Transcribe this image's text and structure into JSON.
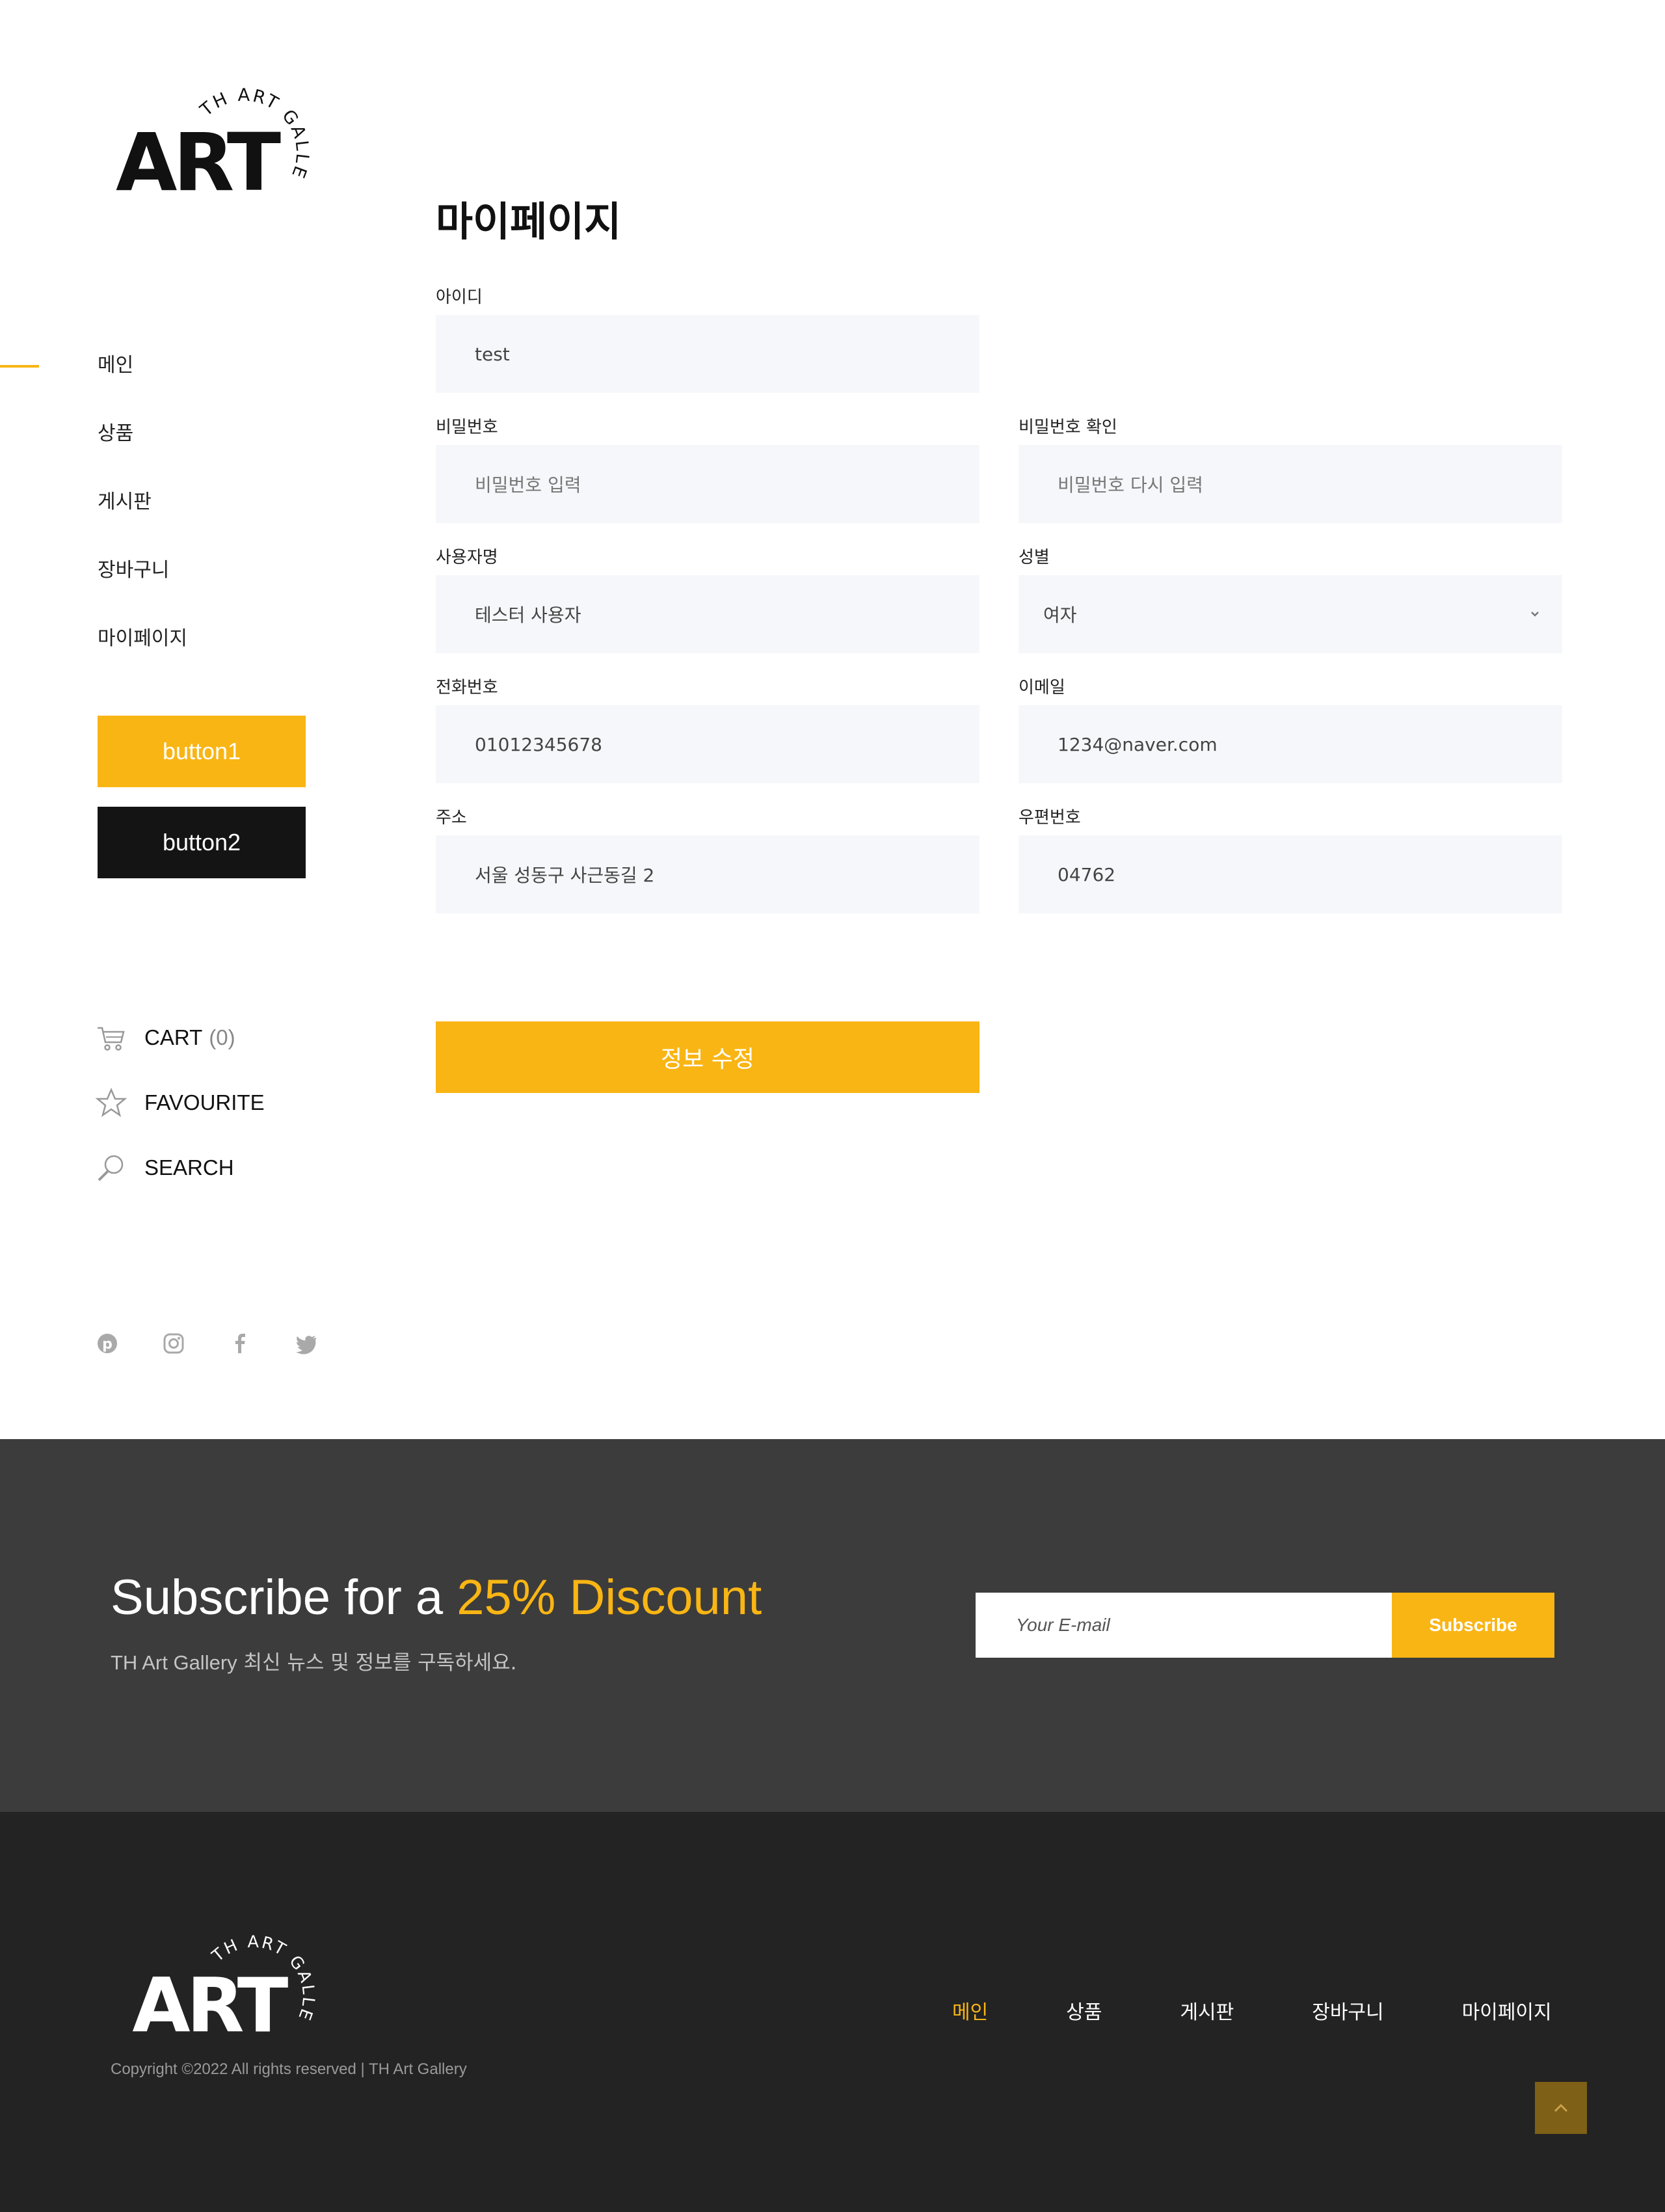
{
  "brand": {
    "logo_text": "ART",
    "logo_arc": "TH ART GALLERY"
  },
  "sidebar": {
    "nav": [
      {
        "label": "메인",
        "active": true
      },
      {
        "label": "상품"
      },
      {
        "label": "게시판"
      },
      {
        "label": "장바구니"
      },
      {
        "label": "마이페이지"
      }
    ],
    "button1": "button1",
    "button2": "button2",
    "tools": {
      "cart_label": "CART",
      "cart_count": "(0)",
      "favourite_label": "FAVOURITE",
      "search_label": "SEARCH"
    },
    "social": [
      "pinterest-icon",
      "instagram-icon",
      "facebook-icon",
      "twitter-icon"
    ]
  },
  "mypage": {
    "title": "마이페이지",
    "fields": {
      "id": {
        "label": "아이디",
        "value": "test"
      },
      "password": {
        "label": "비밀번호",
        "placeholder": "비밀번호 입력"
      },
      "password_confirm": {
        "label": "비밀번호 확인",
        "placeholder": "비밀번호 다시 입력"
      },
      "username": {
        "label": "사용자명",
        "value": "테스터 사용자"
      },
      "gender": {
        "label": "성별",
        "value": "여자"
      },
      "phone": {
        "label": "전화번호",
        "value": "01012345678"
      },
      "email": {
        "label": "이메일",
        "value": "1234@naver.com"
      },
      "address": {
        "label": "주소",
        "value": "서울 성동구 사근동길 2"
      },
      "zipcode": {
        "label": "우편번호",
        "value": "04762"
      }
    },
    "submit_label": "정보 수정"
  },
  "subscribe": {
    "title_prefix": "Subscribe for a ",
    "title_highlight": "25% Discount",
    "desc_brand": "TH Art Gallery",
    "desc_rest": " 최신 뉴스 및 정보를 구독하세요.",
    "email_placeholder": "Your E-mail",
    "button_label": "Subscribe"
  },
  "footer": {
    "copyright": "Copyright ©2022 All rights reserved | TH Art Gallery",
    "nav": [
      {
        "label": "메인",
        "active": true
      },
      {
        "label": "상품"
      },
      {
        "label": "게시판"
      },
      {
        "label": "장바구니"
      },
      {
        "label": "마이페이지"
      }
    ]
  },
  "colors": {
    "accent": "#f9b514",
    "dark": "#141414",
    "subscribe_bg": "#3c3c3c",
    "footer_bg": "#232323",
    "field_bg": "#f6f7fa"
  }
}
